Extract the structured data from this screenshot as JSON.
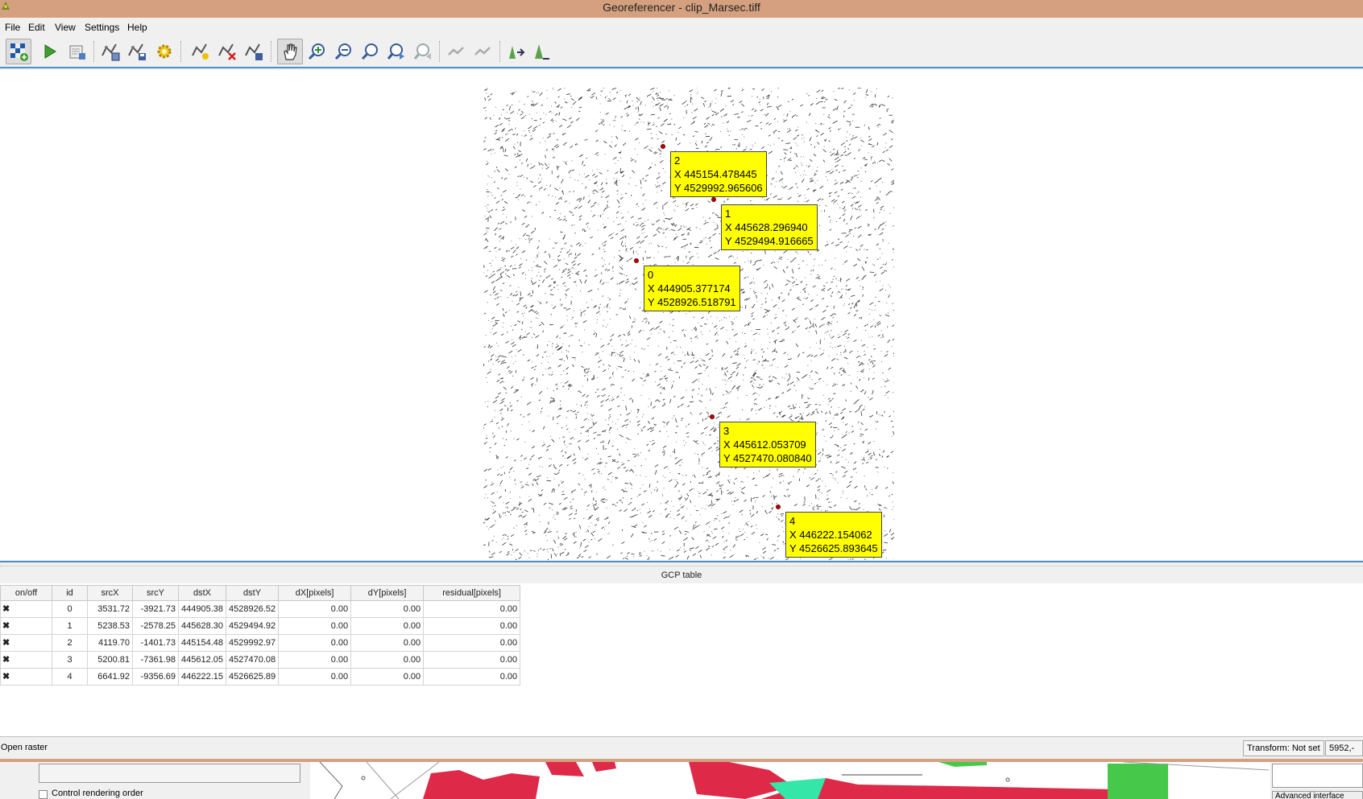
{
  "window": {
    "title": "Georeferencer - clip_Marsec.tiff"
  },
  "menu": {
    "items": [
      "File",
      "Edit",
      "View",
      "Settings",
      "Help"
    ]
  },
  "toolbar": {
    "buttons": [
      {
        "icon": "open-raster-icon"
      },
      {
        "icon": "start-georeferencing-icon"
      },
      {
        "icon": "generate-gdal-script-icon"
      },
      {
        "icon": "load-gcp-points-icon"
      },
      {
        "icon": "save-gcp-points-icon"
      },
      {
        "icon": "transformation-settings-icon"
      },
      {
        "icon": "add-point-icon"
      },
      {
        "icon": "delete-point-icon"
      },
      {
        "icon": "move-gcp-point-icon"
      },
      {
        "icon": "pan-icon"
      },
      {
        "icon": "zoom-in-icon"
      },
      {
        "icon": "zoom-out-icon"
      },
      {
        "icon": "zoom-to-layer-icon"
      },
      {
        "icon": "zoom-last-icon"
      },
      {
        "icon": "zoom-next-icon"
      },
      {
        "icon": "link-georeferencer-to-qgis-icon"
      },
      {
        "icon": "link-qgis-to-georeferencer-icon"
      },
      {
        "icon": "full-histogram-stretch-icon"
      },
      {
        "icon": "local-histogram-stretch-icon"
      }
    ]
  },
  "gcp_markers": [
    {
      "id": "2",
      "x": "X 445154.478445",
      "y": "Y 4529992.965606"
    },
    {
      "id": "1",
      "x": "X 445628.296940",
      "y": "Y 4529494.916665"
    },
    {
      "id": "0",
      "x": "X 444905.377174",
      "y": "Y 4528926.518791"
    },
    {
      "id": "3",
      "x": "X 445612.053709",
      "y": "Y 4527470.080840"
    },
    {
      "id": "4",
      "x": "X 446222.154062",
      "y": "Y 4526625.893645"
    }
  ],
  "gcp_table": {
    "title": "GCP table",
    "columns": [
      "on/off",
      "id",
      "srcX",
      "srcY",
      "dstX",
      "dstY",
      "dX[pixels]",
      "dY[pixels]",
      "residual[pixels]"
    ],
    "rows": [
      {
        "enabled": "✖",
        "id": "0",
        "srcX": "3531.72",
        "srcY": "-3921.73",
        "dstX": "444905.38",
        "dstY": "4528926.52",
        "dX": "0.00",
        "dY": "0.00",
        "residual": "0.00"
      },
      {
        "enabled": "✖",
        "id": "1",
        "srcX": "5238.53",
        "srcY": "-2578.25",
        "dstX": "445628.30",
        "dstY": "4529494.92",
        "dX": "0.00",
        "dY": "0.00",
        "residual": "0.00"
      },
      {
        "enabled": "✖",
        "id": "2",
        "srcX": "4119.70",
        "srcY": "-1401.73",
        "dstX": "445154.48",
        "dstY": "4529992.97",
        "dX": "0.00",
        "dY": "0.00",
        "residual": "0.00"
      },
      {
        "enabled": "✖",
        "id": "3",
        "srcX": "5200.81",
        "srcY": "-7361.98",
        "dstX": "445612.05",
        "dstY": "4527470.08",
        "dX": "0.00",
        "dY": "0.00",
        "residual": "0.00"
      },
      {
        "enabled": "✖",
        "id": "4",
        "srcX": "6641.92",
        "srcY": "-9356.69",
        "dstX": "446222.15",
        "dstY": "4526625.89",
        "dX": "0.00",
        "dY": "0.00",
        "residual": "0.00"
      }
    ]
  },
  "status": {
    "message": "Open raster",
    "transform": "Transform: Not set",
    "coords": "5952,-"
  },
  "background_window": {
    "checkbox_label": "Control rendering order",
    "button_label": "Advanced interface"
  },
  "colors": {
    "titlebar": "#d4a07f",
    "label_bg": "#ffff00",
    "marker": "#c00000",
    "accent": "#4d90c8"
  }
}
